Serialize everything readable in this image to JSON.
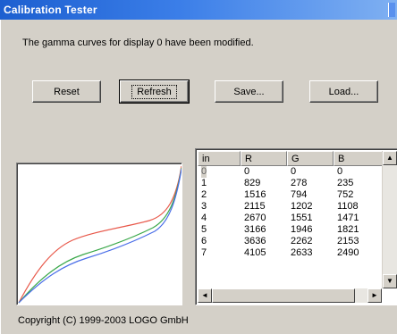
{
  "window": {
    "title": "Calibration Tester"
  },
  "message": "The gamma curves for display 0 have been modified.",
  "buttons": {
    "reset": "Reset",
    "refresh": "Refresh",
    "save": "Save...",
    "load": "Load..."
  },
  "table": {
    "columns": [
      "in",
      "R",
      "G",
      "B"
    ],
    "rows": [
      [
        "0",
        "0",
        "0",
        "0"
      ],
      [
        "1",
        "829",
        "278",
        "235"
      ],
      [
        "2",
        "1516",
        "794",
        "752"
      ],
      [
        "3",
        "2115",
        "1202",
        "1108"
      ],
      [
        "4",
        "2670",
        "1551",
        "1471"
      ],
      [
        "5",
        "3166",
        "1946",
        "1821"
      ],
      [
        "6",
        "3636",
        "2262",
        "2153"
      ],
      [
        "7",
        "4105",
        "2633",
        "2490"
      ]
    ],
    "scroll_arrows": {
      "up": "▲",
      "down": "▼",
      "left": "◄",
      "right": "►"
    }
  },
  "curves": {
    "colors": {
      "red": "#e8584a",
      "green": "#3aa84a",
      "blue": "#4a6ee8"
    }
  },
  "footer": {
    "copyright": "Copyright (C) 1999-2003 LOGO GmbH"
  }
}
